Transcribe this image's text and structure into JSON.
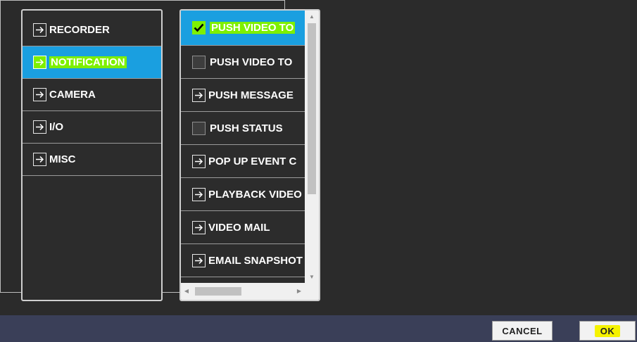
{
  "left_menu": {
    "items": [
      {
        "label": "RECORDER",
        "selected": false
      },
      {
        "label": "NOTIFICATION",
        "selected": true
      },
      {
        "label": "CAMERA",
        "selected": false
      },
      {
        "label": "I/O",
        "selected": false
      },
      {
        "label": "MISC",
        "selected": false
      }
    ]
  },
  "middle_menu": {
    "items": [
      {
        "label": "PUSH VIDEO TO",
        "kind": "checkbox",
        "checked": true,
        "selected": true
      },
      {
        "label": "PUSH VIDEO TO",
        "kind": "checkbox",
        "checked": false,
        "selected": false
      },
      {
        "label": "PUSH MESSAGE",
        "kind": "arrow",
        "selected": false
      },
      {
        "label": "PUSH STATUS",
        "kind": "checkbox",
        "checked": false,
        "selected": false
      },
      {
        "label": "POP UP EVENT C",
        "kind": "arrow",
        "selected": false
      },
      {
        "label": "PLAYBACK VIDEO",
        "kind": "arrow",
        "selected": false
      },
      {
        "label": "VIDEO MAIL",
        "kind": "arrow",
        "selected": false
      },
      {
        "label": "EMAIL SNAPSHOT",
        "kind": "arrow",
        "selected": false
      }
    ]
  },
  "buttons": {
    "cancel": "CANCEL",
    "ok": "OK"
  },
  "colors": {
    "selected": "#1a9fe0",
    "highlight_green": "#7ef000",
    "highlight_yellow": "#f5f200",
    "bottom_bar": "#3a3f58"
  }
}
